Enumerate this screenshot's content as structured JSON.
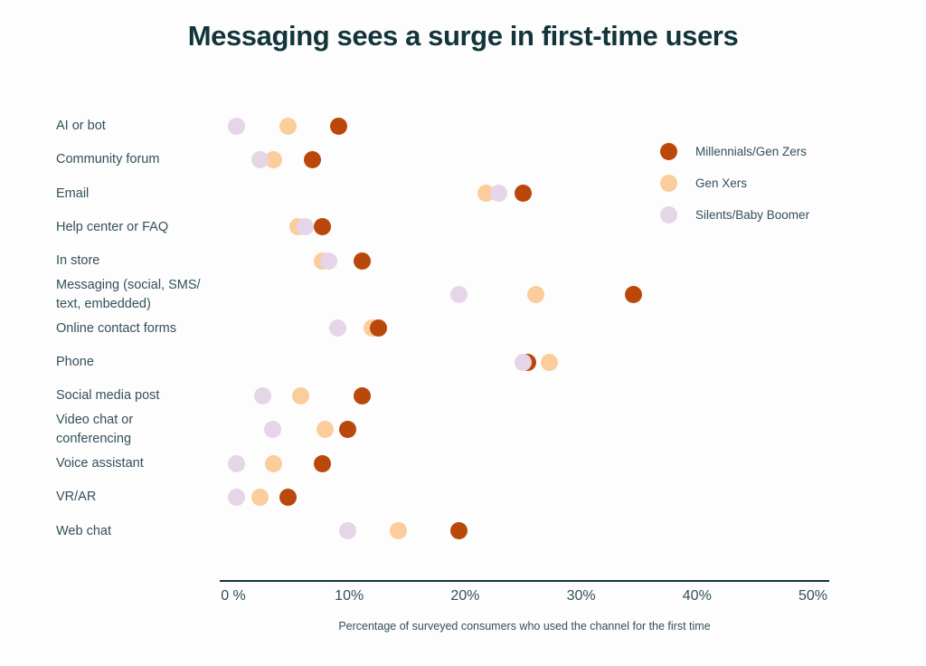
{
  "chart_data": {
    "type": "scatter",
    "title": "Messaging sees a surge in first-time users",
    "xlabel": "Percentage of surveyed consumers who used the channel for the first time",
    "ylabel": "",
    "xlim": [
      0,
      50
    ],
    "xticks": [
      "0 %",
      "10%",
      "20%",
      "30%",
      "40%",
      "50%"
    ],
    "xtick_values": [
      0,
      10,
      20,
      30,
      40,
      50
    ],
    "grid": false,
    "legend_position": "right",
    "categories": [
      "AI or bot",
      "Community forum",
      "Email",
      "Help center or FAQ",
      "In store",
      "Messaging (social, SMS/\ntext, embedded)",
      "Online contact forms",
      "Phone",
      "Social media post",
      "Video chat or\nconferencing",
      "Voice assistant",
      "VR/AR",
      "Web chat"
    ],
    "series": [
      {
        "name": "Millennials/Gen Zers",
        "color": "#b9480a",
        "values": [
          9.1,
          6.8,
          25.0,
          7.7,
          11.1,
          34.5,
          12.5,
          25.4,
          11.1,
          9.9,
          7.7,
          4.7,
          19.5
        ]
      },
      {
        "name": "Gen Xers",
        "color": "#fbcd9c",
        "values": [
          4.7,
          3.5,
          21.8,
          5.6,
          7.7,
          26.1,
          12.0,
          27.3,
          5.8,
          7.9,
          3.5,
          2.3,
          14.2
        ]
      },
      {
        "name": "Silents/Baby Boomer",
        "color": "#e6d5e8",
        "values": [
          0.3,
          2.3,
          22.9,
          6.2,
          8.2,
          19.5,
          9.0,
          25.0,
          2.5,
          3.4,
          0.3,
          0.3,
          9.9
        ]
      }
    ]
  },
  "colors": {
    "title": "#12343b",
    "text": "#33505c",
    "axis": "#12343b",
    "background": "#fdfdfd"
  }
}
